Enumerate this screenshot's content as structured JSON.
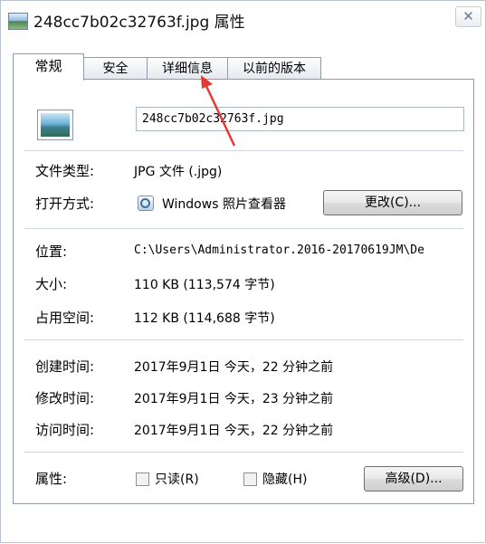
{
  "window": {
    "title": "248cc7b02c32763f.jpg 属性",
    "close_label": "✕"
  },
  "tabs": [
    {
      "label": "常规",
      "active": true
    },
    {
      "label": "安全",
      "active": false
    },
    {
      "label": "详细信息",
      "active": false
    },
    {
      "label": "以前的版本",
      "active": false
    }
  ],
  "general": {
    "file_name": "248cc7b02c32763f.jpg",
    "file_type_label": "文件类型:",
    "file_type_value": "JPG 文件 (.jpg)",
    "opens_with_label": "打开方式:",
    "opens_with_value": "Windows 照片查看器",
    "change_button": "更改(C)...",
    "location_label": "位置:",
    "location_value": "C:\\Users\\Administrator.2016-20170619JM\\De",
    "size_label": "大小:",
    "size_value": "110 KB (113,574 字节)",
    "size_on_disk_label": "占用空间:",
    "size_on_disk_value": "112 KB (114,688 字节)",
    "created_label": "创建时间:",
    "created_value": "2017年9月1日 今天，22 分钟之前",
    "modified_label": "修改时间:",
    "modified_value": "2017年9月1日 今天，23 分钟之前",
    "accessed_label": "访问时间:",
    "accessed_value": "2017年9月1日 今天，22 分钟之前",
    "attributes_label": "属性:",
    "readonly_label": "只读(R)",
    "hidden_label": "隐藏(H)",
    "advanced_button": "高级(D)..."
  },
  "colors": {
    "annotation_arrow": "#e53935"
  },
  "icons": [
    "image-file-icon",
    "photo-viewer-icon",
    "close-icon",
    "annotation-arrow"
  ]
}
